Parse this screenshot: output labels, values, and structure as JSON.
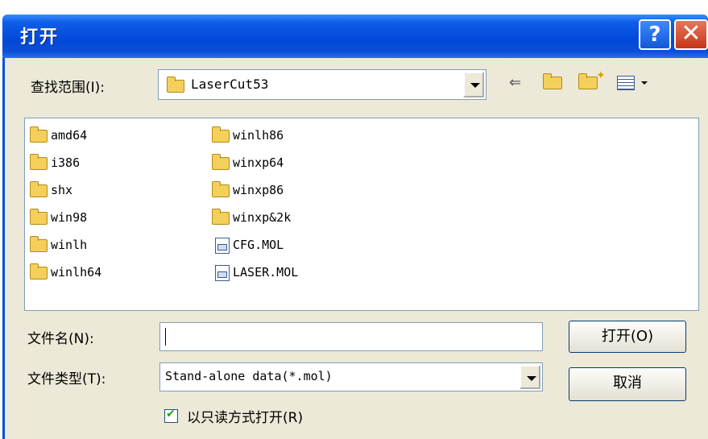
{
  "window": {
    "title": "打开"
  },
  "titlebar_buttons": {
    "help": "?",
    "close": "✕"
  },
  "lookin": {
    "label": "查找范围(I):",
    "value": "LaserCut53"
  },
  "toolbar": {
    "back": "⇐",
    "up_icon": "up-folder-icon",
    "new_folder_icon": "new-folder-icon",
    "view_icon": "view-menu-icon"
  },
  "files": {
    "col1": [
      "amd64",
      "i386",
      "shx",
      "win98",
      "winlh",
      "winlh64"
    ],
    "col2": [
      {
        "name": "winlh86",
        "type": "folder"
      },
      {
        "name": "winxp64",
        "type": "folder"
      },
      {
        "name": "winxp86",
        "type": "folder"
      },
      {
        "name": "winxp&2k",
        "type": "folder"
      },
      {
        "name": "CFG.MOL",
        "type": "file"
      },
      {
        "name": "LASER.MOL",
        "type": "file"
      }
    ]
  },
  "filename": {
    "label": "文件名(N):",
    "value": ""
  },
  "filetype": {
    "label": "文件类型(T):",
    "value": "Stand-alone data(*.mol)"
  },
  "buttons": {
    "open": "打开(O)",
    "cancel": "取消"
  },
  "readonly": {
    "label": "以只读方式打开(R)",
    "checked": true
  },
  "colors": {
    "titlebar": "#0a4fd6",
    "dialog_bg": "#ece9d8",
    "close": "#c5361a"
  }
}
